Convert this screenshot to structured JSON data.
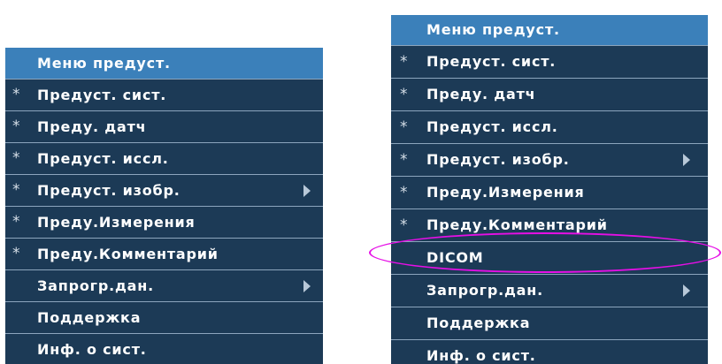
{
  "menu_left": {
    "items": [
      {
        "marker": "",
        "label": "Меню предуст.",
        "has_submenu": false
      },
      {
        "marker": "*",
        "label": "Предуст. сист.",
        "has_submenu": false
      },
      {
        "marker": "*",
        "label": "Преду. датч",
        "has_submenu": false
      },
      {
        "marker": "*",
        "label": "Предуст. иссл.",
        "has_submenu": false
      },
      {
        "marker": "*",
        "label": "Предуст. изобр.",
        "has_submenu": true
      },
      {
        "marker": "*",
        "label": "Преду.Измерения",
        "has_submenu": false
      },
      {
        "marker": "*",
        "label": "Преду.Комментарий",
        "has_submenu": false
      },
      {
        "marker": "",
        "label": "Запрогр.дан.",
        "has_submenu": true
      },
      {
        "marker": "",
        "label": "Поддержка",
        "has_submenu": false
      },
      {
        "marker": "",
        "label": "Инф. о сист.",
        "has_submenu": false
      }
    ]
  },
  "menu_right": {
    "items": [
      {
        "marker": "",
        "label": "Меню предуст.",
        "has_submenu": false
      },
      {
        "marker": "*",
        "label": "Предуст. сист.",
        "has_submenu": false
      },
      {
        "marker": "*",
        "label": "Преду. датч",
        "has_submenu": false
      },
      {
        "marker": "*",
        "label": "Предуст. иссл.",
        "has_submenu": false
      },
      {
        "marker": "*",
        "label": "Предуст. изобр.",
        "has_submenu": true
      },
      {
        "marker": "*",
        "label": "Преду.Измерения",
        "has_submenu": false
      },
      {
        "marker": "*",
        "label": "Преду.Комментарий",
        "has_submenu": false
      },
      {
        "marker": "",
        "label": "DICOM",
        "has_submenu": false
      },
      {
        "marker": "",
        "label": "Запрогр.дан.",
        "has_submenu": true
      },
      {
        "marker": "",
        "label": "Поддержка",
        "has_submenu": false
      },
      {
        "marker": "",
        "label": "Инф. о сист.",
        "has_submenu": false
      }
    ],
    "highlighted_item": "DICOM"
  },
  "colors": {
    "menu_background": "#1c3a56",
    "header_background": "#3b80ba",
    "divider": "#8ca5bd",
    "text": "#ffffff",
    "highlight_ellipse": "#e60fe6"
  }
}
